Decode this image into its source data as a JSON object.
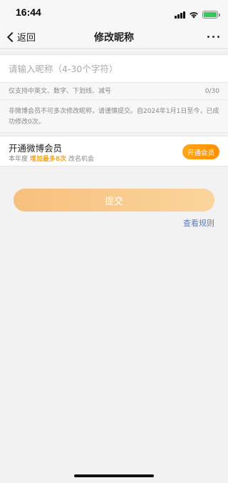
{
  "status_bar": {
    "time": "16:44",
    "icons": [
      "signal-icon",
      "wifi-icon",
      "battery-charging-icon"
    ],
    "battery_color": "#34c759"
  },
  "nav": {
    "back_label": "返回",
    "title": "修改昵称",
    "more_icon": "more-icon"
  },
  "form": {
    "nickname_value": "",
    "nickname_placeholder": "请输入昵称（4-30个字符）",
    "hint": "仅支持中英文、数字、下划线、减号",
    "char_count": "0/30",
    "notice": "非微博会员不可多次修改昵称，请谨慎提交。自2024年1月1日至今，已成功修改0次。"
  },
  "vip": {
    "title": "开通微博会员",
    "desc_prefix": "本年度",
    "desc_highlight": "增加最多8次",
    "desc_suffix": "改名机会",
    "button_label": "开通会员",
    "accent_color": "#f5a623"
  },
  "actions": {
    "submit_label": "提交",
    "rules_link": "查看规则"
  }
}
